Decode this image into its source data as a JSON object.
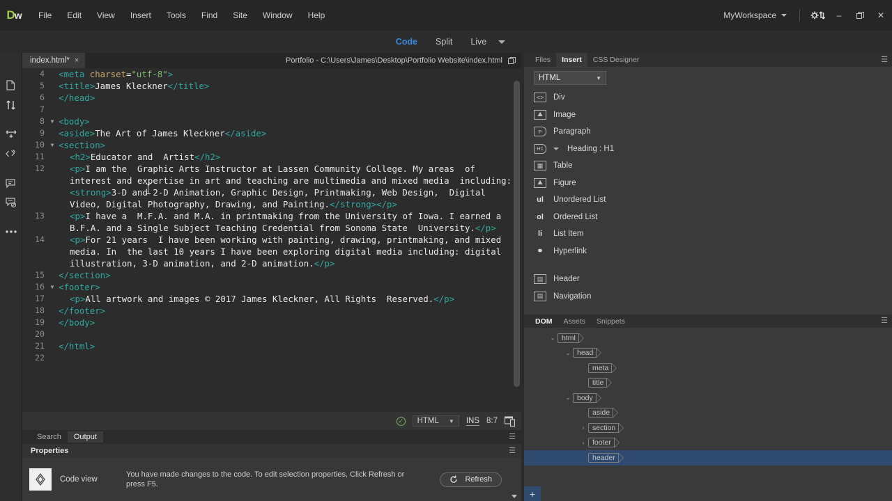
{
  "app": {
    "logo": "Dw",
    "workspace": "MyWorkspace"
  },
  "menu": {
    "items": [
      "File",
      "Edit",
      "View",
      "Insert",
      "Tools",
      "Find",
      "Site",
      "Window",
      "Help"
    ]
  },
  "window_controls": {
    "sync_icon": "gear-sync-icon",
    "minimize": "–",
    "restore": "❐",
    "close": "✕"
  },
  "view_toolbar": {
    "tabs": [
      "Code",
      "Split",
      "Live"
    ],
    "active": "Code"
  },
  "left_rail": {
    "icons": [
      "open-documents-icon",
      "sort-lines-icon",
      "format-source-icon",
      "apply-comment-icon",
      "wrap-tag-icon",
      "remove-comment-icon",
      "more-options-icon"
    ]
  },
  "document": {
    "tab_label": "index.html*",
    "tab_close": "×",
    "path": "Portfolio - C:\\Users\\James\\Desktop\\Portfolio Website\\index.html",
    "restore_glyph": "❐"
  },
  "code": {
    "lines": [
      {
        "num": "4",
        "fold": "",
        "indent": 0,
        "segments": [
          {
            "t": "tag",
            "s": "<meta "
          },
          {
            "t": "attr",
            "s": "charset"
          },
          {
            "t": "txt",
            "s": "="
          },
          {
            "t": "val",
            "s": "\"utf-8\""
          },
          {
            "t": "tag",
            "s": ">"
          }
        ]
      },
      {
        "num": "5",
        "fold": "",
        "indent": 0,
        "segments": [
          {
            "t": "tag",
            "s": "<title>"
          },
          {
            "t": "txt",
            "s": "James Kleckner"
          },
          {
            "t": "tag",
            "s": "</title>"
          }
        ]
      },
      {
        "num": "6",
        "fold": "",
        "indent": 0,
        "segments": [
          {
            "t": "tag",
            "s": "</head>"
          }
        ]
      },
      {
        "num": "7",
        "fold": "",
        "indent": 0,
        "segments": []
      },
      {
        "num": "8",
        "fold": "▼",
        "indent": 0,
        "segments": [
          {
            "t": "tag",
            "s": "<body>"
          }
        ]
      },
      {
        "num": "9",
        "fold": "",
        "indent": 0,
        "segments": [
          {
            "t": "tag",
            "s": "<aside>"
          },
          {
            "t": "txt",
            "s": "The Art of James Kleckner"
          },
          {
            "t": "tag",
            "s": "</aside>"
          }
        ]
      },
      {
        "num": "10",
        "fold": "▼",
        "indent": 0,
        "segments": [
          {
            "t": "tag",
            "s": "<section>"
          }
        ]
      },
      {
        "num": "11",
        "fold": "",
        "indent": 1,
        "segments": [
          {
            "t": "tag",
            "s": "<h2>"
          },
          {
            "t": "txt",
            "s": "Educator and  Artist"
          },
          {
            "t": "tag",
            "s": "</h2>"
          }
        ]
      },
      {
        "num": "12",
        "fold": "",
        "indent": 1,
        "segments": [
          {
            "t": "tag",
            "s": "<p>"
          },
          {
            "t": "txt",
            "s": "I am the  Graphic Arts Instructor at Lassen Community College. My areas  of interest and expertise in art and teaching are multimedia and mixed media  including: "
          },
          {
            "t": "tag",
            "s": "<strong>"
          },
          {
            "t": "txt",
            "s": "3-D and 2-D Animation, Graphic Design, Printmaking, Web Design,  Digital Video, Digital Photography, Drawing, and Painting."
          },
          {
            "t": "tag",
            "s": "</strong></p>"
          }
        ]
      },
      {
        "num": "13",
        "fold": "",
        "indent": 1,
        "segments": [
          {
            "t": "tag",
            "s": "<p>"
          },
          {
            "t": "txt",
            "s": "I have a  M.F.A. and M.A. in printmaking from the University of Iowa. I earned a  B.F.A. and a Single Subject Teaching Credential from Sonoma State  University."
          },
          {
            "t": "tag",
            "s": "</p>"
          }
        ]
      },
      {
        "num": "14",
        "fold": "",
        "indent": 1,
        "segments": [
          {
            "t": "tag",
            "s": "<p>"
          },
          {
            "t": "txt",
            "s": "For 21 years  I have been working with painting, drawing, printmaking, and mixed media. In  the last 10 years I have been exploring digital media including: digital  illustration, 3-D animation, and 2-D animation."
          },
          {
            "t": "tag",
            "s": "</p>"
          }
        ]
      },
      {
        "num": "15",
        "fold": "",
        "indent": 0,
        "segments": [
          {
            "t": "tag",
            "s": "</section>"
          }
        ]
      },
      {
        "num": "16",
        "fold": "▼",
        "indent": 0,
        "segments": [
          {
            "t": "tag",
            "s": "<footer>"
          }
        ]
      },
      {
        "num": "17",
        "fold": "",
        "indent": 1,
        "segments": [
          {
            "t": "tag",
            "s": "<p>"
          },
          {
            "t": "txt",
            "s": "All artwork and images © 2017 James Kleckner, All Rights  Reserved."
          },
          {
            "t": "tag",
            "s": "</p>"
          }
        ]
      },
      {
        "num": "18",
        "fold": "",
        "indent": 0,
        "segments": [
          {
            "t": "tag",
            "s": "</footer>"
          }
        ]
      },
      {
        "num": "19",
        "fold": "",
        "indent": 0,
        "segments": [
          {
            "t": "tag",
            "s": "</body>"
          }
        ]
      },
      {
        "num": "20",
        "fold": "",
        "indent": 0,
        "segments": []
      },
      {
        "num": "21",
        "fold": "",
        "indent": 0,
        "segments": [
          {
            "t": "tag",
            "s": "</html>"
          }
        ]
      },
      {
        "num": "22",
        "fold": "",
        "indent": 0,
        "segments": []
      }
    ]
  },
  "status_bar": {
    "validation_icon": "valid-check-icon",
    "doctype": "HTML",
    "insert_mode": "INS",
    "cursor_position": "8:7",
    "device_preview_icon": "device-preview-icon"
  },
  "output_bar": {
    "tabs": [
      "Search",
      "Output"
    ],
    "active": "Output",
    "menu_icon": "panel-menu-icon"
  },
  "properties": {
    "title": "Properties",
    "icon": "code-view-icon",
    "label": "Code view",
    "message": "You have made changes to the code. To edit selection properties, Click Refresh or press F5.",
    "refresh_label": "Refresh",
    "refresh_icon": "refresh-icon"
  },
  "right_panel": {
    "tabs": [
      "Files",
      "Insert",
      "CSS Designer"
    ],
    "active_tab": "Insert",
    "category_value": "HTML",
    "items": [
      {
        "label": "Div",
        "icon": "div-icon",
        "glyph": "<>",
        "style": "boxed",
        "submenu": false
      },
      {
        "label": "Image",
        "icon": "image-icon",
        "glyph": "⛰",
        "style": "boxed",
        "submenu": false
      },
      {
        "label": "Paragraph",
        "icon": "paragraph-icon",
        "glyph": "P",
        "style": "tagshape",
        "submenu": false
      },
      {
        "label": "Heading : H1",
        "icon": "heading-icon",
        "glyph": "H1",
        "style": "tagshape",
        "submenu": true
      },
      {
        "label": "Table",
        "icon": "table-icon",
        "glyph": "▦",
        "style": "boxed",
        "submenu": false
      },
      {
        "label": "Figure",
        "icon": "figure-icon",
        "glyph": "⛰",
        "style": "boxed",
        "submenu": false
      },
      {
        "label": "Unordered List",
        "icon": "unordered-list-icon",
        "glyph": "ul",
        "style": "plain",
        "submenu": false
      },
      {
        "label": "Ordered List",
        "icon": "ordered-list-icon",
        "glyph": "ol",
        "style": "plain",
        "submenu": false
      },
      {
        "label": "List Item",
        "icon": "list-item-icon",
        "glyph": "li",
        "style": "plain",
        "submenu": false
      },
      {
        "label": "Hyperlink",
        "icon": "hyperlink-icon",
        "glyph": "⚭",
        "style": "plain",
        "submenu": false
      },
      {
        "label": "__GAP__",
        "icon": "",
        "glyph": "",
        "style": "",
        "submenu": false
      },
      {
        "label": "Header",
        "icon": "header-icon",
        "glyph": "▤",
        "style": "boxed",
        "submenu": false
      },
      {
        "label": "Navigation",
        "icon": "navigation-icon",
        "glyph": "▤",
        "style": "boxed",
        "submenu": false
      }
    ]
  },
  "dom_panel": {
    "tabs": [
      "DOM",
      "Assets",
      "Snippets"
    ],
    "active_tab": "DOM",
    "add_button": "+",
    "nodes": [
      {
        "label": "html",
        "depth": 1,
        "arrow": "⌄",
        "selected": false
      },
      {
        "label": "head",
        "depth": 2,
        "arrow": "⌄",
        "selected": false
      },
      {
        "label": "meta",
        "depth": 3,
        "arrow": "",
        "selected": false
      },
      {
        "label": "title",
        "depth": 3,
        "arrow": "",
        "selected": false
      },
      {
        "label": "body",
        "depth": 2,
        "arrow": "⌄",
        "selected": false
      },
      {
        "label": "aside",
        "depth": 3,
        "arrow": "",
        "selected": false
      },
      {
        "label": "section",
        "depth": 3,
        "arrow": "›",
        "selected": false
      },
      {
        "label": "footer",
        "depth": 3,
        "arrow": "›",
        "selected": false
      },
      {
        "label": "header",
        "depth": 3,
        "arrow": "",
        "selected": true
      }
    ]
  },
  "colors": {
    "accent_blue": "#3c8ade",
    "tag": "#2fa8a0",
    "attribute": "#c9a86a",
    "value": "#7dbd6f",
    "selection": "#2e4a6e",
    "panel_bg": "#3a3a3a",
    "editor_bg": "#2c2c2c"
  }
}
